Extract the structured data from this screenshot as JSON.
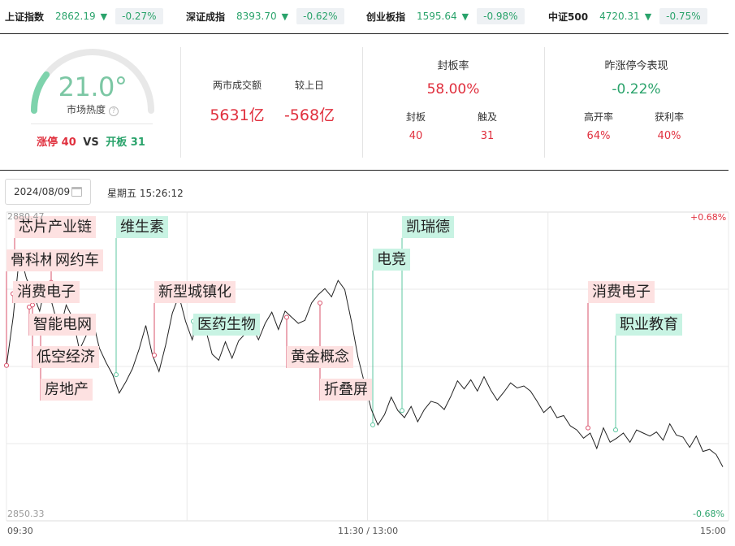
{
  "indices": [
    {
      "name": "上证指数",
      "value": "2862.19",
      "pct": "-0.27%"
    },
    {
      "name": "深证成指",
      "value": "8393.70",
      "pct": "-0.62%"
    },
    {
      "name": "创业板指",
      "value": "1595.64",
      "pct": "-0.98%"
    },
    {
      "name": "中证500",
      "value": "4720.31",
      "pct": "-0.75%"
    }
  ],
  "down_arrow": "▼",
  "heat": {
    "value": "21.0°",
    "label": "市场热度",
    "help_icon": "?",
    "level": 0.21,
    "limit_up_label": "涨停",
    "limit_up_count": "40",
    "vs_label": "VS",
    "opened_label": "开板",
    "opened_count": "31"
  },
  "volume": {
    "turnover_label": "两市成交额",
    "turnover_value": "5631亿",
    "compare_label": "较上日",
    "compare_value": "-568亿"
  },
  "seal": {
    "title": "封板率",
    "rate": "58.00%",
    "sealed_label": "封板",
    "sealed_value": "40",
    "touched_label": "触及",
    "touched_value": "31"
  },
  "yesterday": {
    "title": "昨涨停今表现",
    "value": "-0.22%",
    "high_open_label": "高开率",
    "high_open_value": "64%",
    "profit_label": "获利率",
    "profit_value": "40%"
  },
  "date": "2024/08/09",
  "weekday_time": "星期五 15:26:12",
  "colors": {
    "up": "#e0303e",
    "down": "#2aa36b",
    "tag_red": "#fde1e1",
    "tag_green": "#c8f3e3"
  },
  "icons": {
    "arrow": "down-arrow-icon",
    "calendar": "calendar-icon",
    "help": "question-icon"
  },
  "chart_data": {
    "type": "line",
    "y_max_label": "2880.47",
    "y_min_label": "2850.33",
    "pct_max_label": "+0.68%",
    "pct_min_label": "-0.68%",
    "ylim": [
      2850.33,
      2880.47
    ],
    "x_ticks": [
      "09:30",
      "11:30 / 13:00",
      "15:00"
    ],
    "series": [
      {
        "values": [
          2865.5,
          2870.2,
          2876.5,
          2874.0,
          2872.5,
          2870.8,
          2873.6,
          2871.2,
          2868.8,
          2871.4,
          2870.1,
          2867.0,
          2868.4,
          2869.9,
          2867.2,
          2865.8,
          2864.6,
          2862.8,
          2863.9,
          2865.2,
          2867.1,
          2869.4,
          2866.5,
          2864.9,
          2867.5,
          2870.6,
          2872.3,
          2869.8,
          2868.0,
          2870.4,
          2869.1,
          2866.6,
          2866.0,
          2867.8,
          2866.2,
          2867.9,
          2868.6,
          2869.3,
          2868.0,
          2869.6,
          2870.7,
          2869.0,
          2870.8,
          2870.2,
          2869.6,
          2869.9,
          2871.6,
          2872.4,
          2873.0,
          2872.2,
          2873.8,
          2872.9,
          2869.8,
          2866.3,
          2863.7,
          2861.2,
          2859.7,
          2860.7,
          2862.4,
          2861.1,
          2860.4,
          2861.5,
          2860.0,
          2861.2,
          2862.0,
          2861.8,
          2861.2,
          2862.5,
          2864.0,
          2863.2,
          2864.1,
          2863.0,
          2864.4,
          2863.1,
          2862.1,
          2862.9,
          2863.8,
          2863.3,
          2863.5,
          2863.0,
          2862.0,
          2860.9,
          2861.5,
          2860.4,
          2860.6,
          2859.6,
          2859.2,
          2858.4,
          2858.9,
          2857.4,
          2859.4,
          2858.0,
          2858.4,
          2858.9,
          2858.0,
          2859.2,
          2858.9,
          2858.6,
          2859.0,
          2858.2,
          2859.8,
          2858.7,
          2858.5,
          2857.5,
          2858.6,
          2857.1,
          2857.3,
          2856.8,
          2855.6
        ],
        "up_limit": 2880.47,
        "down_limit": 2850.33
      }
    ],
    "annotations": [
      {
        "label": "芯片产业链",
        "color": "red"
      },
      {
        "label": "骨科林",
        "color": "red"
      },
      {
        "label": "网约车",
        "color": "red"
      },
      {
        "label": "消费电子",
        "color": "red"
      },
      {
        "label": "智能电网",
        "color": "red"
      },
      {
        "label": "低空经济",
        "color": "red"
      },
      {
        "label": "房地产",
        "color": "red"
      },
      {
        "label": "维生素",
        "color": "green"
      },
      {
        "label": "新型城镇化",
        "color": "red"
      },
      {
        "label": "医药生物",
        "color": "green"
      },
      {
        "label": "黄金概念",
        "color": "red"
      },
      {
        "label": "折叠屏",
        "color": "red"
      },
      {
        "label": "电竞",
        "color": "green"
      },
      {
        "label": "凯瑞德",
        "color": "green"
      },
      {
        "label": "消费电子",
        "color": "red"
      },
      {
        "label": "职业教育",
        "color": "green"
      }
    ]
  }
}
